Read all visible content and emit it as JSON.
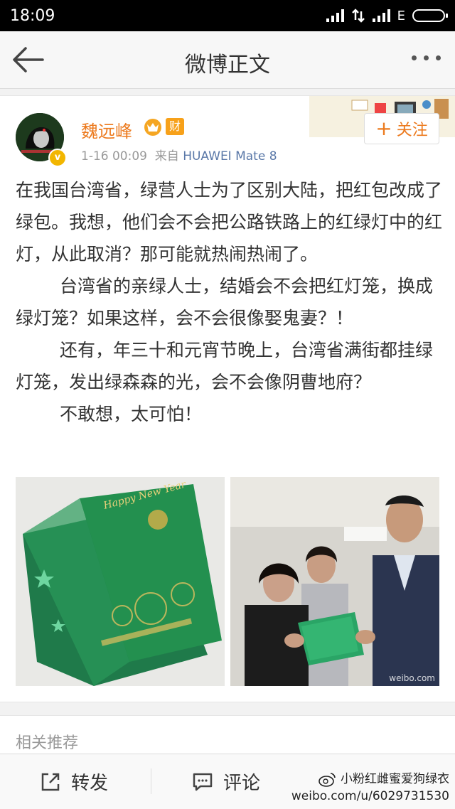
{
  "status_bar": {
    "time": "18:09",
    "network": "E"
  },
  "nav": {
    "title": "微博正文"
  },
  "post": {
    "username": "魏远峰",
    "vip_badge_text": "财",
    "verified_mark": "v",
    "time": "1-16 00:09",
    "source_prefix": "来自",
    "source": "HUAWEI Mate 8",
    "follow_label": "关注",
    "paragraphs": [
      "在我国台湾省，绿营人士为了区别大陆，把红包改成了绿包。我想，他们会不会把公路铁路上的红绿灯中的红灯，从此取消？那可能就热闹热闹了。",
      "台湾省的亲绿人士，结婚会不会把红灯笼，换成绿灯笼？如果这样，会不会很像娶鬼妻？！",
      "还有，年三十和元宵节晚上，台湾省满街都挂绿灯笼，发出绿森森的光，会不会像阴曹地府？",
      "不敢想，太可怕！"
    ],
    "images": [
      {
        "alt": "green-envelope-photo",
        "text": "Happy New Year"
      },
      {
        "alt": "people-holding-green-envelope-photo",
        "text": "weibo.com"
      }
    ]
  },
  "related": {
    "label": "相关推荐"
  },
  "bottom_bar": {
    "repost_label": "转发",
    "comment_label": "评论",
    "watermark_line1": "小粉红雌蜜爱狗绿衣",
    "watermark_line2": "weibo.com/u/6029731530"
  },
  "colors": {
    "accent": "#ec7a1e",
    "link": "#5a78a8"
  }
}
